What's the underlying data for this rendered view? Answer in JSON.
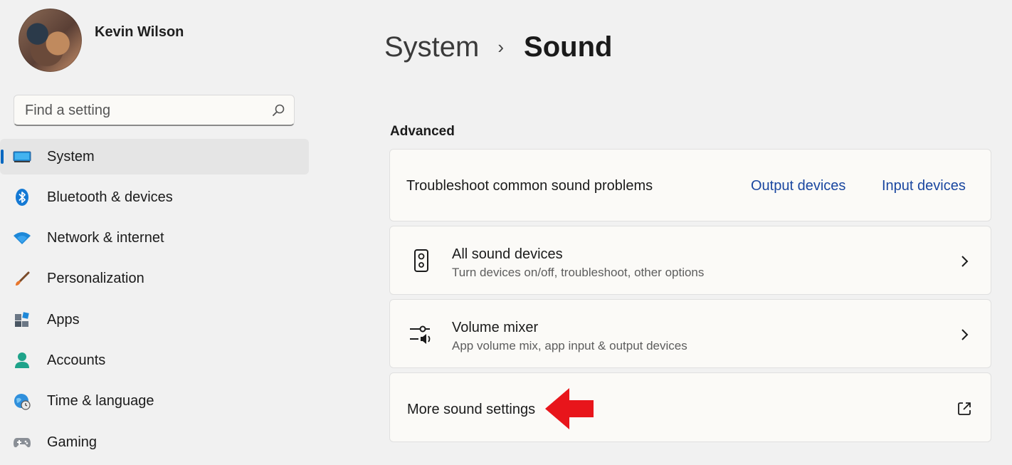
{
  "profile": {
    "name": "Kevin Wilson"
  },
  "search": {
    "placeholder": "Find a setting"
  },
  "sidebar": {
    "items": [
      {
        "label": "System",
        "icon": "system-monitor-icon",
        "active": true
      },
      {
        "label": "Bluetooth & devices",
        "icon": "bluetooth-icon"
      },
      {
        "label": "Network & internet",
        "icon": "wifi-icon"
      },
      {
        "label": "Personalization",
        "icon": "brush-icon"
      },
      {
        "label": "Apps",
        "icon": "apps-icon"
      },
      {
        "label": "Accounts",
        "icon": "accounts-icon"
      },
      {
        "label": "Time & language",
        "icon": "globe-clock-icon"
      },
      {
        "label": "Gaming",
        "icon": "gamepad-icon"
      }
    ]
  },
  "breadcrumb": {
    "parent": "System",
    "separator": "›",
    "current": "Sound"
  },
  "main": {
    "section_title": "Advanced",
    "troubleshoot": {
      "label": "Troubleshoot common sound problems",
      "link_output": "Output devices",
      "link_input": "Input devices"
    },
    "all_sound_devices": {
      "title": "All sound devices",
      "subtitle": "Turn devices on/off, troubleshoot, other options",
      "icon": "speaker-icon"
    },
    "volume_mixer": {
      "title": "Volume mixer",
      "subtitle": "App volume mix, app input & output devices",
      "icon": "volume-mixer-icon"
    },
    "more_sound_settings": {
      "label": "More sound settings",
      "icon": "open-external-icon"
    }
  },
  "colors": {
    "accent": "#0067c0",
    "link": "#1a47a0",
    "annotation_arrow": "#e8151b",
    "background": "#f1f1f1",
    "card": "#fbfaf7"
  }
}
